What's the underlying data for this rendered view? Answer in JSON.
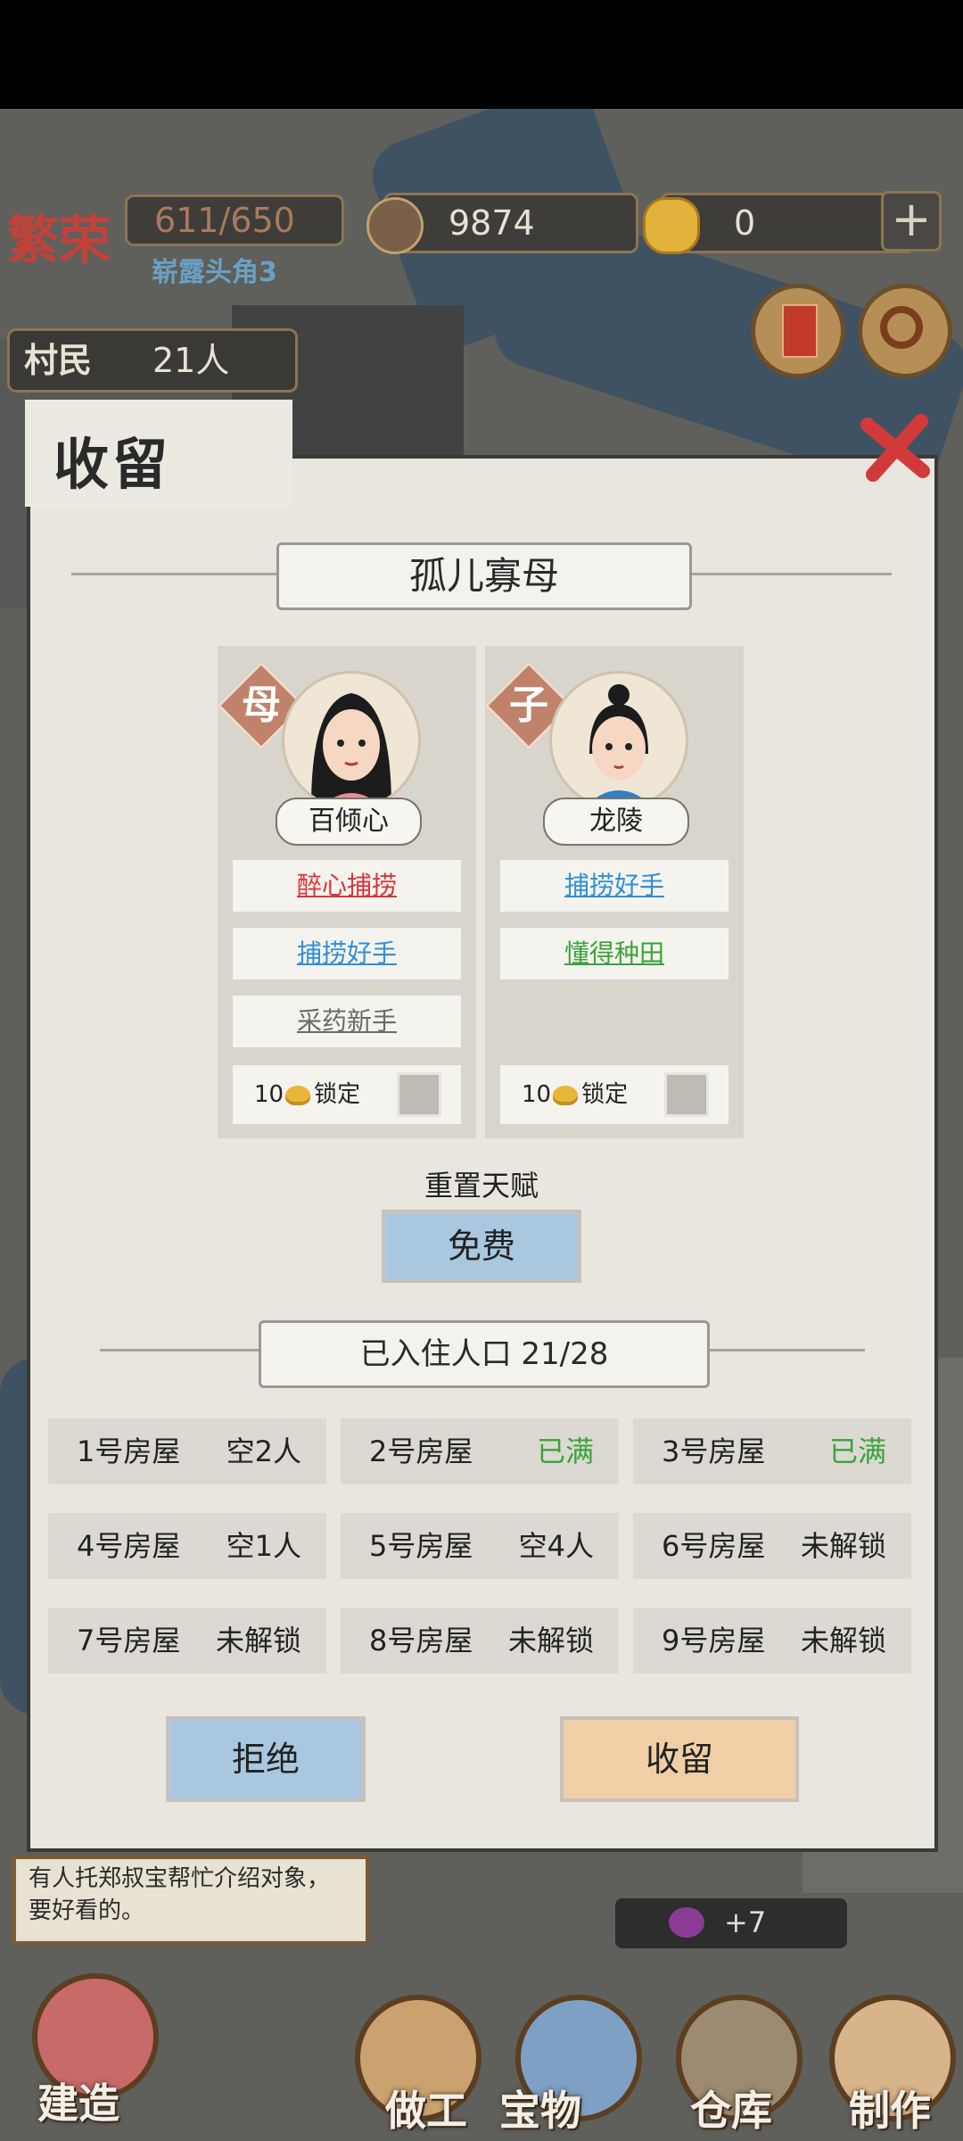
{
  "hud": {
    "prosperity_label": "繁荣",
    "prosperity_value": "611/650",
    "rank": "崭露头角3",
    "coins": "9874",
    "ingots": "0",
    "villagers_label": "村民",
    "villagers_count": "21人"
  },
  "dialog": {
    "title": "收留",
    "subtitle": "孤儿寡母",
    "cards": [
      {
        "role_tag": "母",
        "name": "百倾心",
        "talents": [
          {
            "text": "醉心捕捞",
            "color": "#d9343a"
          },
          {
            "text": "捕捞好手",
            "color": "#2f8fd6"
          },
          {
            "text": "采药新手",
            "color": "#6a6a6a"
          }
        ],
        "lock_cost": "10",
        "lock_label": "锁定"
      },
      {
        "role_tag": "子",
        "name": "龙陵",
        "talents": [
          {
            "text": "捕捞好手",
            "color": "#2f8fd6"
          },
          {
            "text": "懂得种田",
            "color": "#3aa33b"
          }
        ],
        "lock_cost": "10",
        "lock_label": "锁定"
      }
    ],
    "reset_label": "重置天赋",
    "reset_button": "免费",
    "population_label": "已入住人口 21/28",
    "houses": [
      {
        "name": "1号房屋",
        "status": "空2人"
      },
      {
        "name": "2号房屋",
        "status": "已满"
      },
      {
        "name": "3号房屋",
        "status": "已满"
      },
      {
        "name": "4号房屋",
        "status": "空1人"
      },
      {
        "name": "5号房屋",
        "status": "空4人"
      },
      {
        "name": "6号房屋",
        "status": "未解锁"
      },
      {
        "name": "7号房屋",
        "status": "未解锁"
      },
      {
        "name": "8号房屋",
        "status": "未解锁"
      },
      {
        "name": "9号房屋",
        "status": "未解锁"
      }
    ],
    "reject_button": "拒绝",
    "accept_button": "收留"
  },
  "event": {
    "text": "有人托郑叔宝帮忙介绍对象，要好看的。"
  },
  "notice": {
    "badge": "+7"
  },
  "bottom_nav": [
    "建造",
    "做工",
    "宝物",
    "仓库",
    "制作"
  ],
  "colors": {
    "reject_button": "#a9c8e0",
    "accept_button": "#f0cfa6",
    "free_button": "#a9c8e0",
    "full_status": "#3aa33b"
  }
}
